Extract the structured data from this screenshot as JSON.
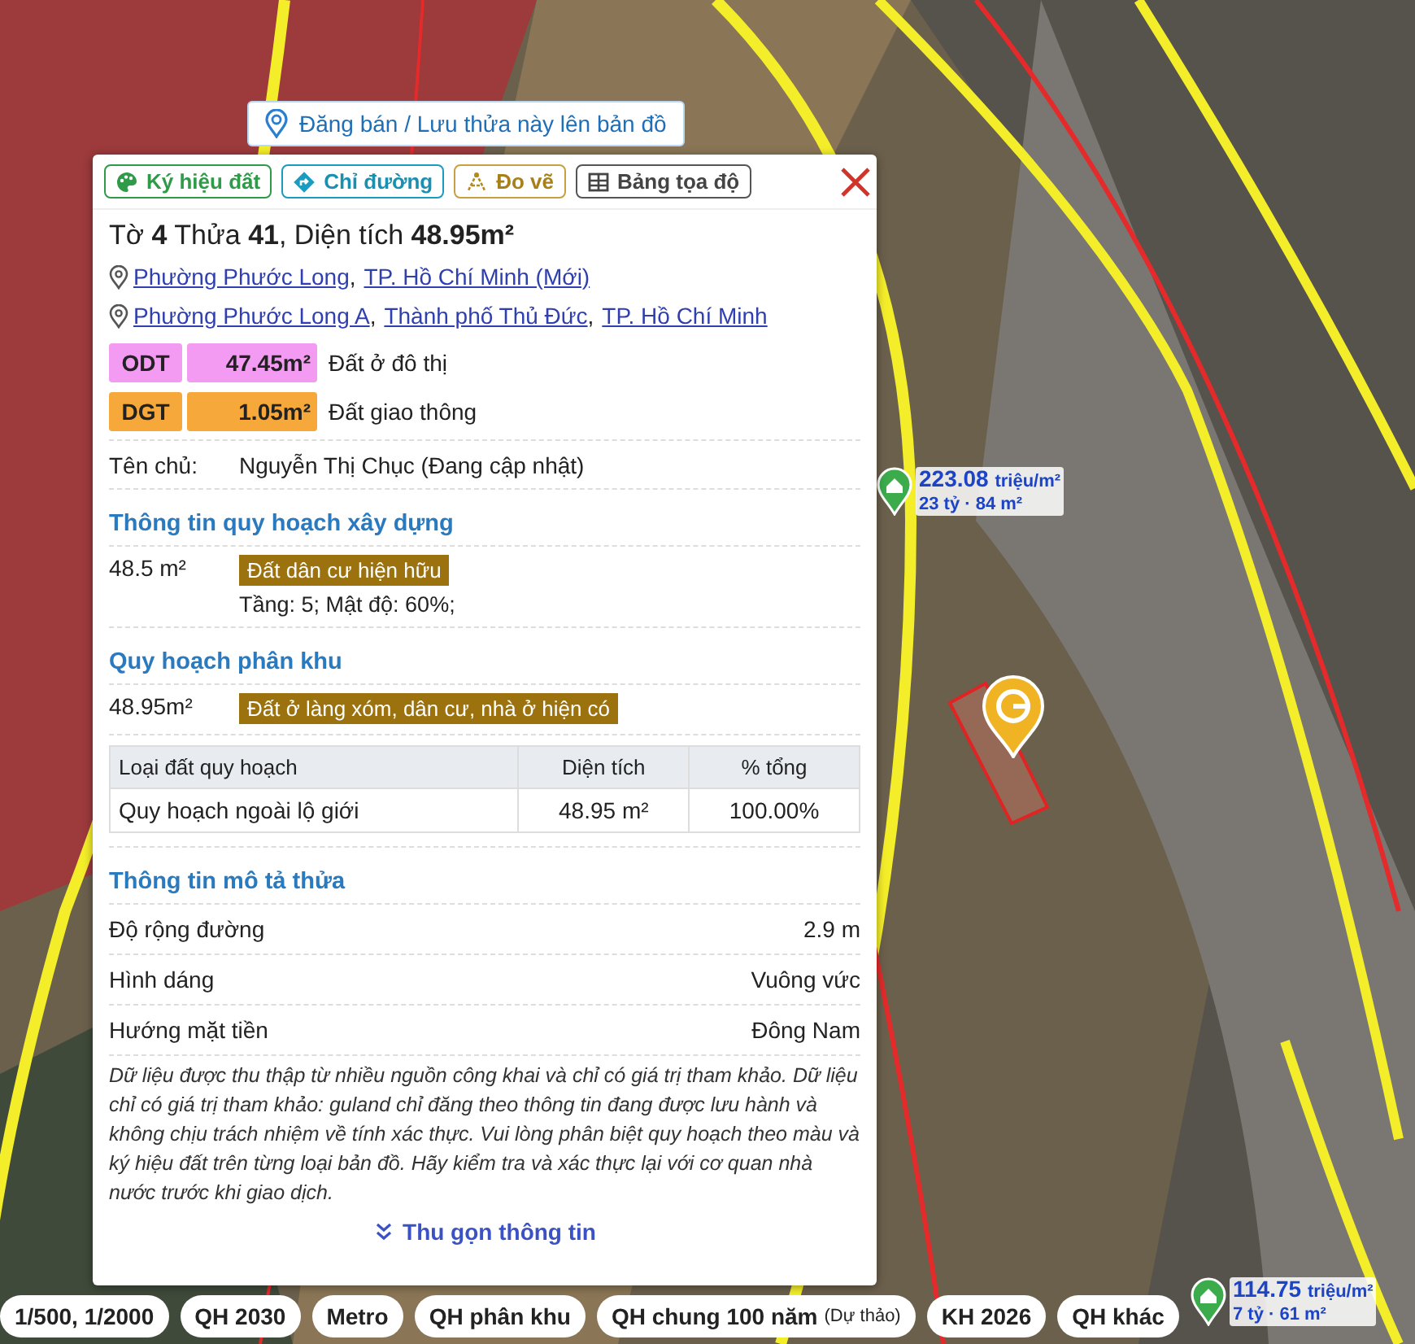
{
  "map": {
    "price_markers": [
      {
        "price": "223.08",
        "unit": "triệu/m²",
        "summary": "23 tỷ · 84 m²"
      },
      {
        "price": "114.75",
        "unit": "triệu/m²",
        "summary": "7 tỷ · 61 m²"
      }
    ]
  },
  "post_button": {
    "label": "Đăng bán / Lưu thửa này lên bản đồ"
  },
  "popup": {
    "toolbar": [
      {
        "label": "Ký hiệu đất",
        "kind": "palette"
      },
      {
        "label": "Chỉ đường",
        "kind": "directions"
      },
      {
        "label": "Đo vẽ",
        "kind": "measure"
      },
      {
        "label": "Bảng tọa độ",
        "kind": "table"
      }
    ],
    "title": "Tờ **4** Thửa **41**, Diện tích **48.95m²**",
    "addresses": [
      [
        {
          "text": "Phường Phước Long",
          "suffix": ","
        },
        {
          "text": "TP. Hồ Chí Minh (Mới)"
        }
      ],
      [
        {
          "text": "Phường Phước Long A",
          "suffix": ","
        },
        {
          "text": "Thành phố Thủ Đức",
          "suffix": ","
        },
        {
          "text": "TP. Hồ Chí Minh"
        }
      ]
    ],
    "land_uses": [
      {
        "code": "ODT",
        "area": "47.45m²",
        "name": "Đất ở đô thị",
        "color": "#f39af3"
      },
      {
        "code": "DGT",
        "area": "1.05m²",
        "name": "Đất giao thông",
        "color": "#f7a83a"
      }
    ],
    "owner": {
      "label": "Tên chủ:",
      "value": "Nguyễn Thị Chục (Đang cập nhật)"
    },
    "construction_planning": {
      "title": "Thông tin quy hoạch xây dựng",
      "area": "48.5 m²",
      "tag": "Đất dân cư hiện hữu",
      "note": "Tầng: 5; Mật độ: 60%;"
    },
    "zoning": {
      "title": "Quy hoạch phân khu",
      "area": "48.95m²",
      "tag": "Đất ở làng xóm, dân cư, nhà ở hiện có",
      "table": {
        "columns": [
          "Loại đất quy hoạch",
          "Diện tích",
          "% tổng"
        ],
        "rows": [
          [
            "Quy hoạch ngoài lộ giới",
            "48.95 m²",
            "100.00%"
          ]
        ]
      }
    },
    "description": {
      "title": "Thông tin mô tả thửa",
      "rows": [
        {
          "label": "Độ rộng đường",
          "value": "2.9 m"
        },
        {
          "label": "Hình dáng",
          "value": "Vuông vức"
        },
        {
          "label": "Hướng mặt tiền",
          "value": "Đông Nam"
        }
      ],
      "disclaimer": "Dữ liệu được thu thập từ nhiều nguồn công khai và chỉ có giá trị tham khảo. Dữ liệu chỉ có giá trị tham khảo: guland chỉ đăng theo thông tin đang được lưu hành và không chịu trách nhiệm về tính xác thực. Vui lòng phân biệt quy hoạch theo màu và ký hiệu đất trên từng loại bản đồ. Hãy kiểm tra và xác thực lại với cơ quan nhà nước trước khi giao dịch."
    },
    "collapse_button": {
      "label": "Thu gọn thông tin"
    }
  },
  "layer_chips": [
    {
      "label": "1/500, 1/2000"
    },
    {
      "label": "QH 2030"
    },
    {
      "label": "Metro"
    },
    {
      "label": "QH phân khu"
    },
    {
      "label": "QH chung 100 năm",
      "note": "(Dự thảo)"
    },
    {
      "label": "KH 2026"
    },
    {
      "label": "QH khác"
    }
  ]
}
